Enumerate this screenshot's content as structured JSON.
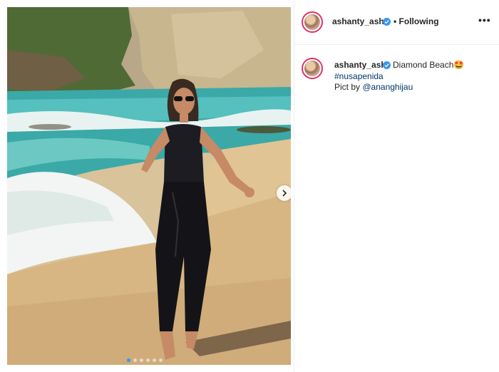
{
  "post": {
    "author": "ashanty_ash",
    "header_following": "• Following",
    "more_label": "•••",
    "caption_username": "ashanty_ash",
    "caption_text": "Diamond Beach🤩",
    "hashtag": "#nusapenida",
    "credit_prefix": "Pict by ",
    "credit_mention": "@ananghijau",
    "carousel_total": 6,
    "carousel_index": 1,
    "photo_alt": "Woman in sunglasses and black outfit walking on a sandy beach with waves and cliffs"
  },
  "colors": {
    "accent": "#3897f0",
    "story_ring": "#e1306c",
    "link": "#00376b",
    "text": "#262626"
  },
  "icons": [
    "verified-badge-icon",
    "chevron-right-icon",
    "more-options-icon"
  ]
}
